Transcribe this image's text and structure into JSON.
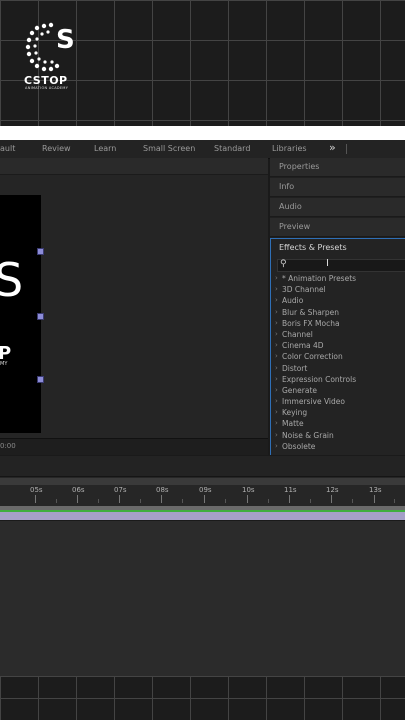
{
  "logo": {
    "text": "CSTOP",
    "subtext": "ANIMATION ACADEMY"
  },
  "workspace": {
    "tabs": [
      {
        "label": "ault"
      },
      {
        "label": "Review"
      },
      {
        "label": "Learn"
      },
      {
        "label": "Small Screen"
      },
      {
        "label": "Standard"
      },
      {
        "label": "Libraries"
      }
    ],
    "more_icon": "double-chevron-right"
  },
  "composition": {
    "canvas_letter": "S",
    "canvas_p": "P",
    "canvas_y": "MY",
    "timecode": "0:00"
  },
  "right_panels": {
    "tabs": [
      {
        "label": "Properties"
      },
      {
        "label": "Info"
      },
      {
        "label": "Audio"
      },
      {
        "label": "Preview"
      }
    ]
  },
  "effects_presets": {
    "title": "Effects & Presets",
    "search_placeholder": "",
    "items": [
      {
        "label": "* Animation Presets"
      },
      {
        "label": "3D Channel"
      },
      {
        "label": "Audio"
      },
      {
        "label": "Blur & Sharpen"
      },
      {
        "label": "Boris FX Mocha"
      },
      {
        "label": "Channel"
      },
      {
        "label": "Cinema 4D"
      },
      {
        "label": "Color Correction"
      },
      {
        "label": "Distort"
      },
      {
        "label": "Expression Controls"
      },
      {
        "label": "Generate"
      },
      {
        "label": "Immersive Video"
      },
      {
        "label": "Keying"
      },
      {
        "label": "Matte"
      },
      {
        "label": "Noise & Grain"
      },
      {
        "label": "Obsolete"
      }
    ]
  },
  "timeline": {
    "ruler": [
      "05s",
      "06s",
      "07s",
      "08s",
      "09s",
      "10s",
      "11s",
      "12s",
      "13s"
    ]
  },
  "colors": {
    "panel_focus": "#2f6fb6",
    "layer_bar": "#a5a0c8",
    "layer_green": "#3fae3f"
  }
}
